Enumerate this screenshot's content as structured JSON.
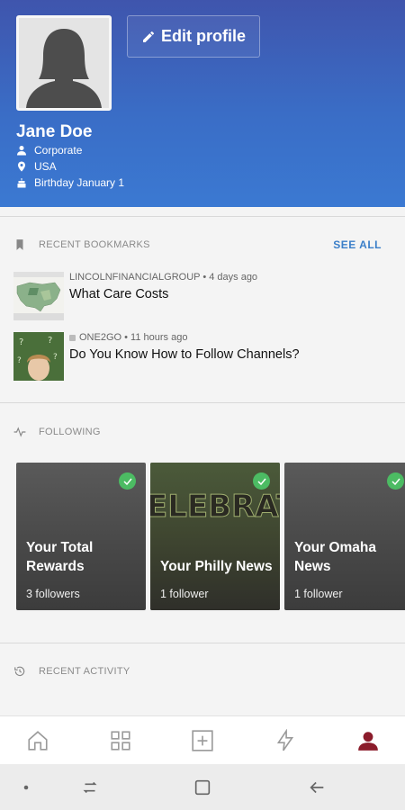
{
  "profile": {
    "name": "Jane Doe",
    "edit_label": "Edit profile",
    "department": "Corporate",
    "location": "USA",
    "birthday": "Birthday January 1"
  },
  "bookmarks": {
    "heading": "RECENT BOOKMARKS",
    "see_all": "SEE ALL",
    "items": [
      {
        "source": "LINCOLNFINANCIALGROUP • 4 days ago",
        "title": "What Care Costs"
      },
      {
        "source": "ONE2GO • 11 hours ago",
        "title": "Do You Know How to Follow Channels?"
      }
    ]
  },
  "following": {
    "heading": "FOLLOWING",
    "cards": [
      {
        "name": "Your Total Rewards",
        "followers": "3 followers"
      },
      {
        "name": "Your Philly News",
        "followers": "1 follower",
        "bg_text": "ELEBRATE JUNETEENTH"
      },
      {
        "name": "Your Omaha News",
        "followers": "1 follower"
      }
    ]
  },
  "activity": {
    "heading": "RECENT ACTIVITY"
  },
  "nav": {
    "items": [
      "home-icon",
      "grid-icon",
      "add-icon",
      "bolt-icon",
      "profile-icon"
    ],
    "active": "profile-icon",
    "active_color": "#8b1c2b"
  },
  "colors": {
    "accent": "#3b7fc9",
    "check": "#4cbb63",
    "header_top": "#3f55ad",
    "header_bottom": "#3b79d2"
  }
}
